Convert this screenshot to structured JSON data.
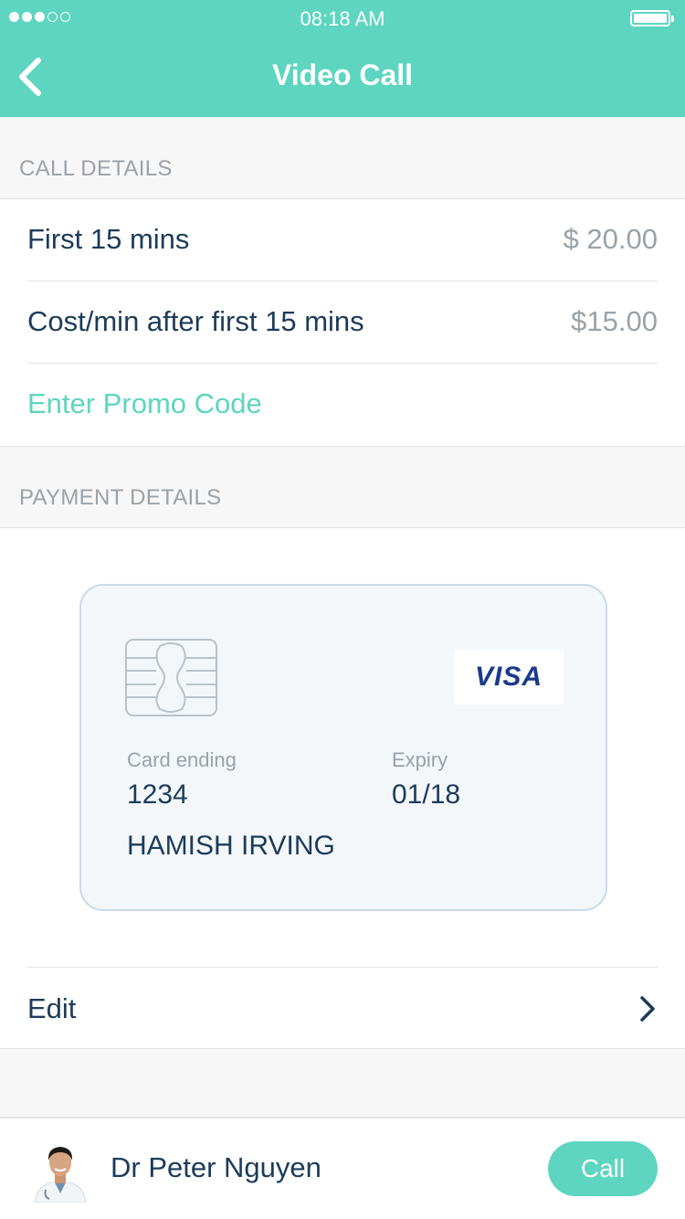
{
  "status_bar": {
    "time": "08:18 AM",
    "signal_bars_filled": 3,
    "signal_bars_total": 5
  },
  "nav": {
    "title": "Video Call",
    "back_icon": "chevron-left-icon"
  },
  "call_details": {
    "header": "CALL DETAILS",
    "rows": [
      {
        "label": "First 15 mins",
        "price": "$ 20.00"
      },
      {
        "label": "Cost/min after first 15 mins",
        "price": "$15.00"
      }
    ],
    "promo_label": "Enter Promo Code"
  },
  "payment_details": {
    "header": "PAYMENT DETAILS",
    "card": {
      "brand": "VISA",
      "card_ending_label": "Card ending",
      "card_ending": "1234",
      "expiry_label": "Expiry",
      "expiry": "01/18",
      "holder": "HAMISH IRVING"
    },
    "edit_label": "Edit"
  },
  "bottom_bar": {
    "doctor_name": "Dr Peter Nguyen",
    "call_label": "Call"
  },
  "colors": {
    "accent": "#5dd5c0",
    "text_primary": "#1d3b5a",
    "text_muted": "#9aa2a8"
  }
}
